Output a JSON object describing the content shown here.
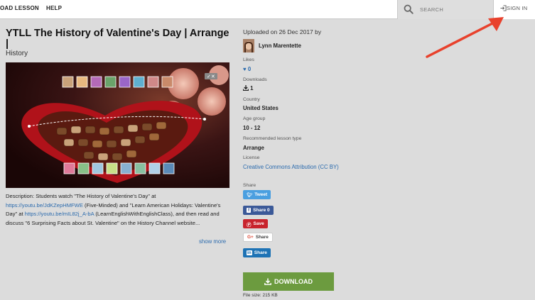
{
  "nav": {
    "upload_lesson": "OAD LESSON",
    "help": "HELP",
    "search_placeholder": "SEARCH",
    "sign_in": "SIGN IN"
  },
  "lesson": {
    "title": "YTLL The History of Valentine's Day | Arrange |",
    "category": "History",
    "description_parts": {
      "p1": "Description: Students watch \"The History of Valentine's Day\" at ",
      "link1": "https://youtu.be/JdKZepHMFWE",
      "p2": " (Five-Minded) and \"Learn American Holidays: Valentine's Day\" at ",
      "link2": "https://youtu.be/mIL82j_A-bA",
      "p3": " (LearnEnglishWithEnglishClass), and then read and discuss \"6 Surprising Facts about St. Valentine\" on the History Channel website..."
    },
    "show_more": "show more"
  },
  "meta": {
    "uploaded": "Uploaded on 26 Dec 2017 by",
    "author": "Lynn Marentette",
    "likes_label": "Likes",
    "likes_value": "0",
    "downloads_label": "Downloads",
    "downloads_value": "1",
    "country_label": "Country",
    "country_value": "United States",
    "age_label": "Age group",
    "age_value": "10 - 12",
    "type_label": "Recommended lesson type",
    "type_value": "Arrange",
    "license_label": "License",
    "license_value": "Creative Commons Attribution (CC BY)",
    "share_label": "Share"
  },
  "share": {
    "tweet": "Tweet",
    "facebook": "Share 0",
    "pinterest": "Save",
    "google": "Share",
    "linkedin": "Share"
  },
  "download": {
    "label": "DOWNLOAD",
    "file_size": "File size: 215 KB"
  },
  "colors": {
    "accent_blue": "#2a6aad",
    "download_green": "#6c9b3f",
    "twitter": "#4a9fe0",
    "facebook": "#3b5998",
    "pinterest": "#c8232c",
    "linkedin": "#1e73b5",
    "arrow_red": "#e8412c"
  }
}
